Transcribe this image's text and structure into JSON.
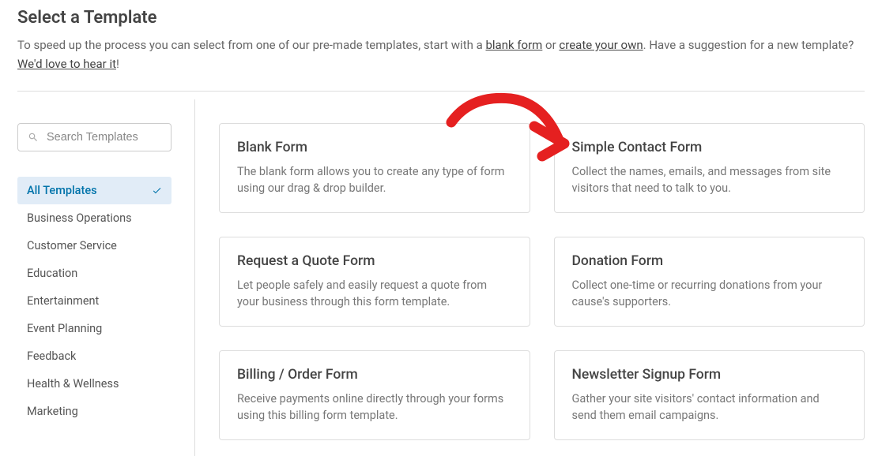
{
  "header": {
    "title": "Select a Template",
    "desc_part1": "To speed up the process you can select from one of our pre-made templates, start with a ",
    "link_blank_form": "blank form",
    "desc_part2": " or ",
    "link_create_own": "create your own",
    "desc_part3": ". Have a suggestion for a new template? ",
    "link_hear_it": "We'd love to hear it",
    "desc_part4": "!"
  },
  "search": {
    "placeholder": "Search Templates"
  },
  "categories": [
    {
      "label": "All Templates",
      "active": true
    },
    {
      "label": "Business Operations",
      "active": false
    },
    {
      "label": "Customer Service",
      "active": false
    },
    {
      "label": "Education",
      "active": false
    },
    {
      "label": "Entertainment",
      "active": false
    },
    {
      "label": "Event Planning",
      "active": false
    },
    {
      "label": "Feedback",
      "active": false
    },
    {
      "label": "Health & Wellness",
      "active": false
    },
    {
      "label": "Marketing",
      "active": false
    }
  ],
  "templates": [
    {
      "title": "Blank Form",
      "desc": "The blank form allows you to create any type of form using our drag & drop builder."
    },
    {
      "title": "Simple Contact Form",
      "desc": "Collect the names, emails, and messages from site visitors that need to talk to you."
    },
    {
      "title": "Request a Quote Form",
      "desc": "Let people safely and easily request a quote from your business through this form template."
    },
    {
      "title": "Donation Form",
      "desc": "Collect one-time or recurring donations from your cause's supporters."
    },
    {
      "title": "Billing / Order Form",
      "desc": "Receive payments online directly through your forms using this billing form template."
    },
    {
      "title": "Newsletter Signup Form",
      "desc": "Gather your site visitors' contact information and send them email campaigns."
    }
  ]
}
